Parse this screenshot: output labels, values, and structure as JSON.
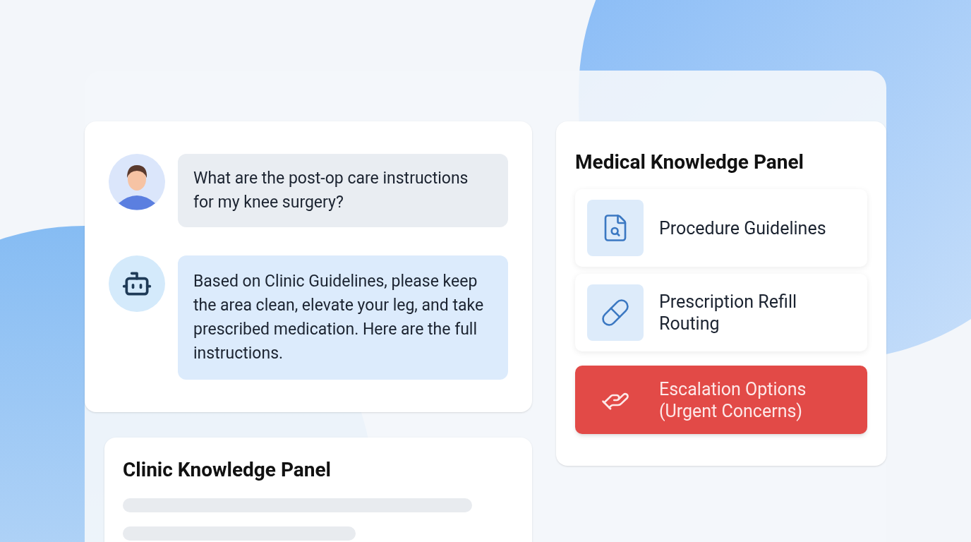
{
  "chat": {
    "messages": [
      {
        "kind": "user",
        "text": "What are the post-op care instructions for my knee surgery?"
      },
      {
        "kind": "bot",
        "text": "Based on Clinic Guidelines, please keep the area clean, elevate your leg, and take prescribed medication. Here are the full instructions."
      }
    ]
  },
  "clinic_panel": {
    "title": "Clinic Knowledge Panel"
  },
  "medical_panel": {
    "title": "Medical Knowledge Panel",
    "items": [
      {
        "kind": "guidelines",
        "label": "Procedure Guidelines",
        "urgent": false
      },
      {
        "kind": "prescription",
        "label": "Prescription Refill Routing",
        "urgent": false
      },
      {
        "kind": "escalation",
        "label": "Escalation Options (Urgent Concerns)",
        "urgent": true
      }
    ]
  }
}
